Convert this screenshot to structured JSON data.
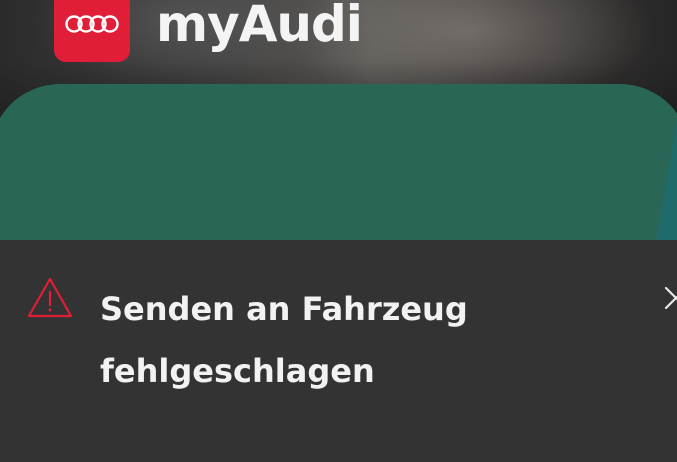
{
  "header": {
    "app_title": "myAudi",
    "logo_icon": "audi-rings-icon",
    "logo_color": "#e01e37"
  },
  "card": {
    "color": "#2a6656"
  },
  "toast": {
    "severity": "error",
    "icon": "warning-triangle-icon",
    "icon_color": "#e01e37",
    "message_line1": "Senden an Fahrzeug",
    "message_line2": "fehlgeschlagen",
    "close_icon": "close-icon",
    "background": "#333333"
  }
}
